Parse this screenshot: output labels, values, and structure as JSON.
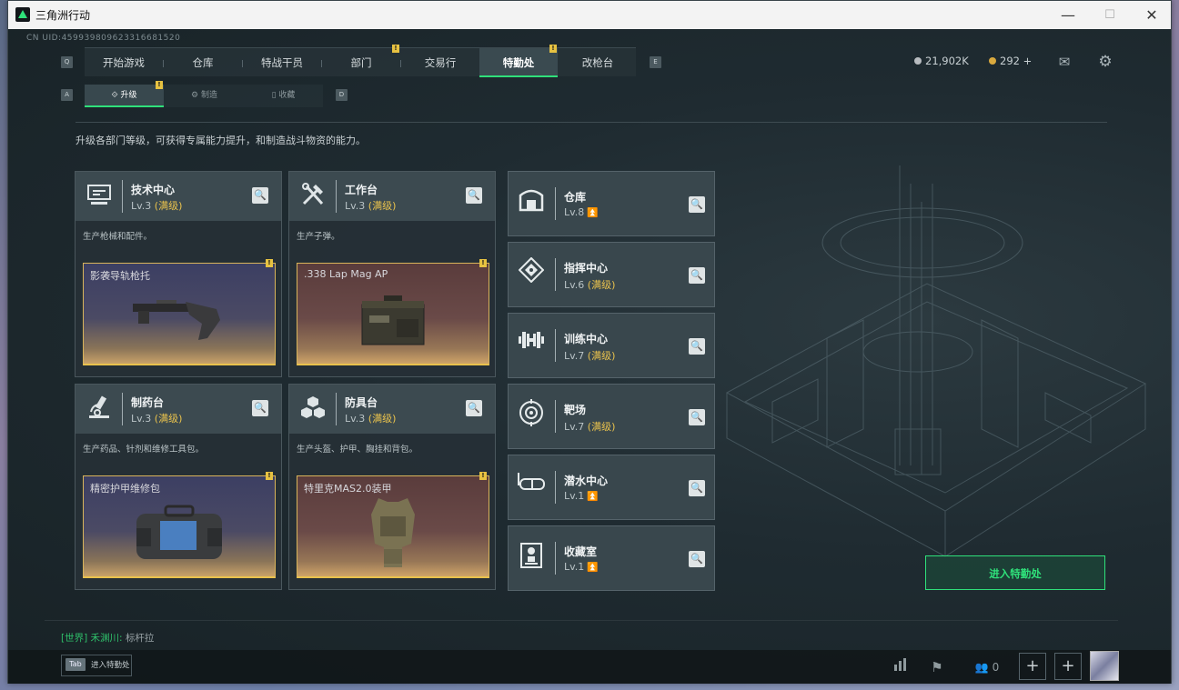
{
  "window": {
    "title": "三角洲行动",
    "minimize": "—",
    "maximize": "☐",
    "close": "✕"
  },
  "uid": "CN UID:459939809623316681520",
  "nav": {
    "left_key": "Q",
    "right_key": "E",
    "items": [
      {
        "label": "开始游戏"
      },
      {
        "label": "仓库"
      },
      {
        "label": "特战干员"
      },
      {
        "label": "部门",
        "badge": "!"
      },
      {
        "label": "交易行"
      },
      {
        "label": "特勤处",
        "badge": "!",
        "active": true
      },
      {
        "label": "改枪台"
      }
    ]
  },
  "currency": {
    "silver": "21,902K",
    "gold": "292",
    "gold_add": "+"
  },
  "subnav": {
    "left_key": "A",
    "right_key": "D",
    "items": [
      {
        "label": "升级",
        "badge": "!",
        "active": true
      },
      {
        "label": "制造"
      },
      {
        "label": "收藏"
      }
    ]
  },
  "description": "升级各部门等级，可获得专属能力提升，和制造战斗物资的能力。",
  "cards": [
    {
      "name": "技术中心",
      "level": "Lv.3",
      "status": "(满级)",
      "desc": "生产枪械和配件。",
      "item": "影袭导轨枪托",
      "item_badge": "!",
      "tone": "blue",
      "icon": "computer-icon"
    },
    {
      "name": "工作台",
      "level": "Lv.3",
      "status": "(满级)",
      "desc": "生产子弹。",
      "item": ".338 Lap Mag AP",
      "item_badge": "!",
      "tone": "red",
      "icon": "tools-icon"
    },
    {
      "name": "制药台",
      "level": "Lv.3",
      "status": "(满级)",
      "desc": "生产药品、针剂和维修工具包。",
      "item": "精密护甲维修包",
      "item_badge": "!",
      "tone": "blue",
      "icon": "microscope-icon"
    },
    {
      "name": "防具台",
      "level": "Lv.3",
      "status": "(满级)",
      "desc": "生产头盔、护甲、胸挂和背包。",
      "item": "特里克MAS2.0装甲",
      "item_badge": "!",
      "tone": "red",
      "icon": "cubes-icon"
    }
  ],
  "facilities": [
    {
      "name": "仓库",
      "level": "Lv.8",
      "status": "",
      "upgradable": true,
      "icon": "warehouse-icon"
    },
    {
      "name": "指挥中心",
      "level": "Lv.6",
      "status": "(满级)",
      "upgradable": false,
      "icon": "command-icon"
    },
    {
      "name": "训练中心",
      "level": "Lv.7",
      "status": "(满级)",
      "upgradable": false,
      "icon": "dumbbell-icon"
    },
    {
      "name": "靶场",
      "level": "Lv.7",
      "status": "(满级)",
      "upgradable": false,
      "icon": "target-icon"
    },
    {
      "name": "潜水中心",
      "level": "Lv.1",
      "status": "",
      "upgradable": true,
      "icon": "goggles-icon"
    },
    {
      "name": "收藏室",
      "level": "Lv.1",
      "status": "",
      "upgradable": true,
      "icon": "trophy-icon"
    }
  ],
  "enter_button": "进入特勤处",
  "chat": {
    "channel": "[世界]",
    "user": "禾渊川:",
    "message": "标杆拉"
  },
  "tab_hint": {
    "key": "Tab",
    "label": "进入特勤处"
  },
  "friends_count": "0",
  "colors": {
    "accent": "#2fe07a",
    "gold": "#e9c24d",
    "badge": "#e7c241"
  }
}
